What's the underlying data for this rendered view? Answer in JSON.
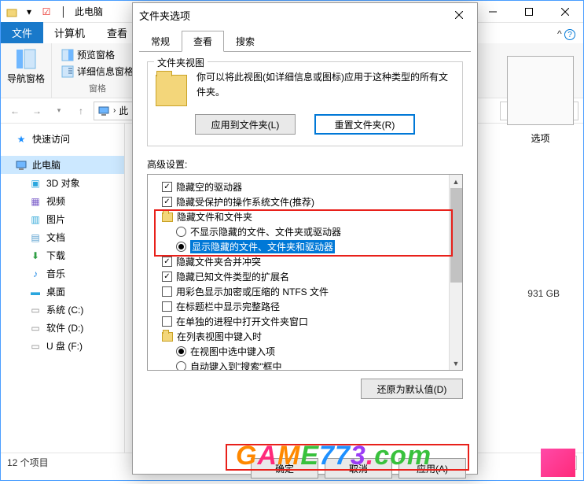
{
  "explorer": {
    "title": "此电脑",
    "ribbon": {
      "file": "文件",
      "computer": "计算机",
      "view": "查看"
    },
    "toolbar": {
      "nav_pane": "导航窗格",
      "preview_pane": "预览窗格",
      "details_pane": "详细信息窗格",
      "group_panes": "窗格"
    },
    "addr": {
      "crumb": "此"
    },
    "nav": {
      "quick_access": "快速访问",
      "this_pc": "此电脑",
      "objects3d": "3D 对象",
      "videos": "视频",
      "pictures": "图片",
      "documents": "文档",
      "downloads": "下载",
      "music": "音乐",
      "desktop": "桌面",
      "drive_c": "系统 (C:)",
      "drive_d": "软件 (D:)",
      "drive_f": "U 盘 (F:)"
    },
    "status": "12 个项目",
    "right": {
      "options": "选项",
      "drive_info": "931 GB"
    }
  },
  "dialog": {
    "title": "文件夹选项",
    "tabs": {
      "general": "常规",
      "view": "查看",
      "search": "搜索"
    },
    "folder_view": {
      "group": "文件夹视图",
      "desc": "你可以将此视图(如详细信息或图标)应用于这种类型的所有文件夹。",
      "apply_btn": "应用到文件夹(L)",
      "reset_btn": "重置文件夹(R)"
    },
    "advanced_label": "高级设置:",
    "tree": {
      "hide_empty_drives": "隐藏空的驱动器",
      "hide_protected_os": "隐藏受保护的操作系统文件(推荐)",
      "hidden_folder": "隐藏文件和文件夹",
      "opt_not_show": "不显示隐藏的文件、文件夹或驱动器",
      "opt_show": "显示隐藏的文件、文件夹和驱动器",
      "hide_conflict": "隐藏文件夹合并冲突",
      "hide_ext": "隐藏已知文件类型的扩展名",
      "color_ntfs": "用彩色显示加密或压缩的 NTFS 文件",
      "show_full_path": "在标题栏中显示完整路径",
      "separate_process": "在单独的进程中打开文件夹窗口",
      "click_in_list": "在列表视图中键入时",
      "select_in_view": "在视图中选中键入项",
      "auto_input": "自动键入到\"搜索\"框中"
    },
    "restore_defaults": "还原为默认值(D)",
    "footer": {
      "ok": "确定",
      "cancel": "取消",
      "apply": "应用(A)"
    }
  },
  "watermark": "GAME773.com"
}
